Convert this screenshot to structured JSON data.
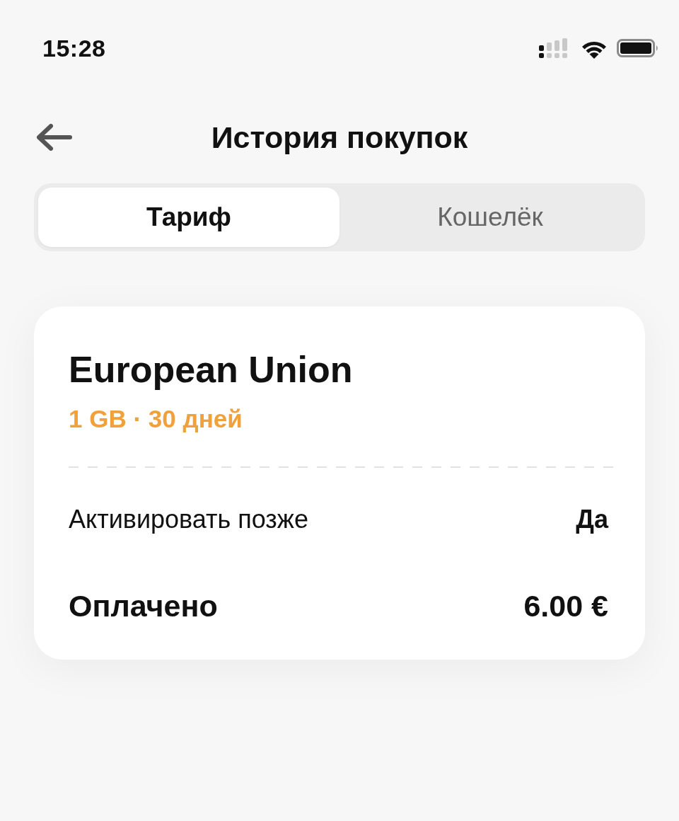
{
  "status_bar": {
    "time": "15:28"
  },
  "header": {
    "title": "История покупок"
  },
  "tabs": [
    {
      "label": "Тариф",
      "selected": true
    },
    {
      "label": "Кошелёк",
      "selected": false
    }
  ],
  "card": {
    "title": "European Union",
    "subtitle": "1 GB · 30 дней",
    "details": [
      {
        "kind": "regular",
        "label": "Активировать позже",
        "value": "Да"
      },
      {
        "kind": "total",
        "label": "Оплачено",
        "value": "6.00 €"
      }
    ]
  }
}
